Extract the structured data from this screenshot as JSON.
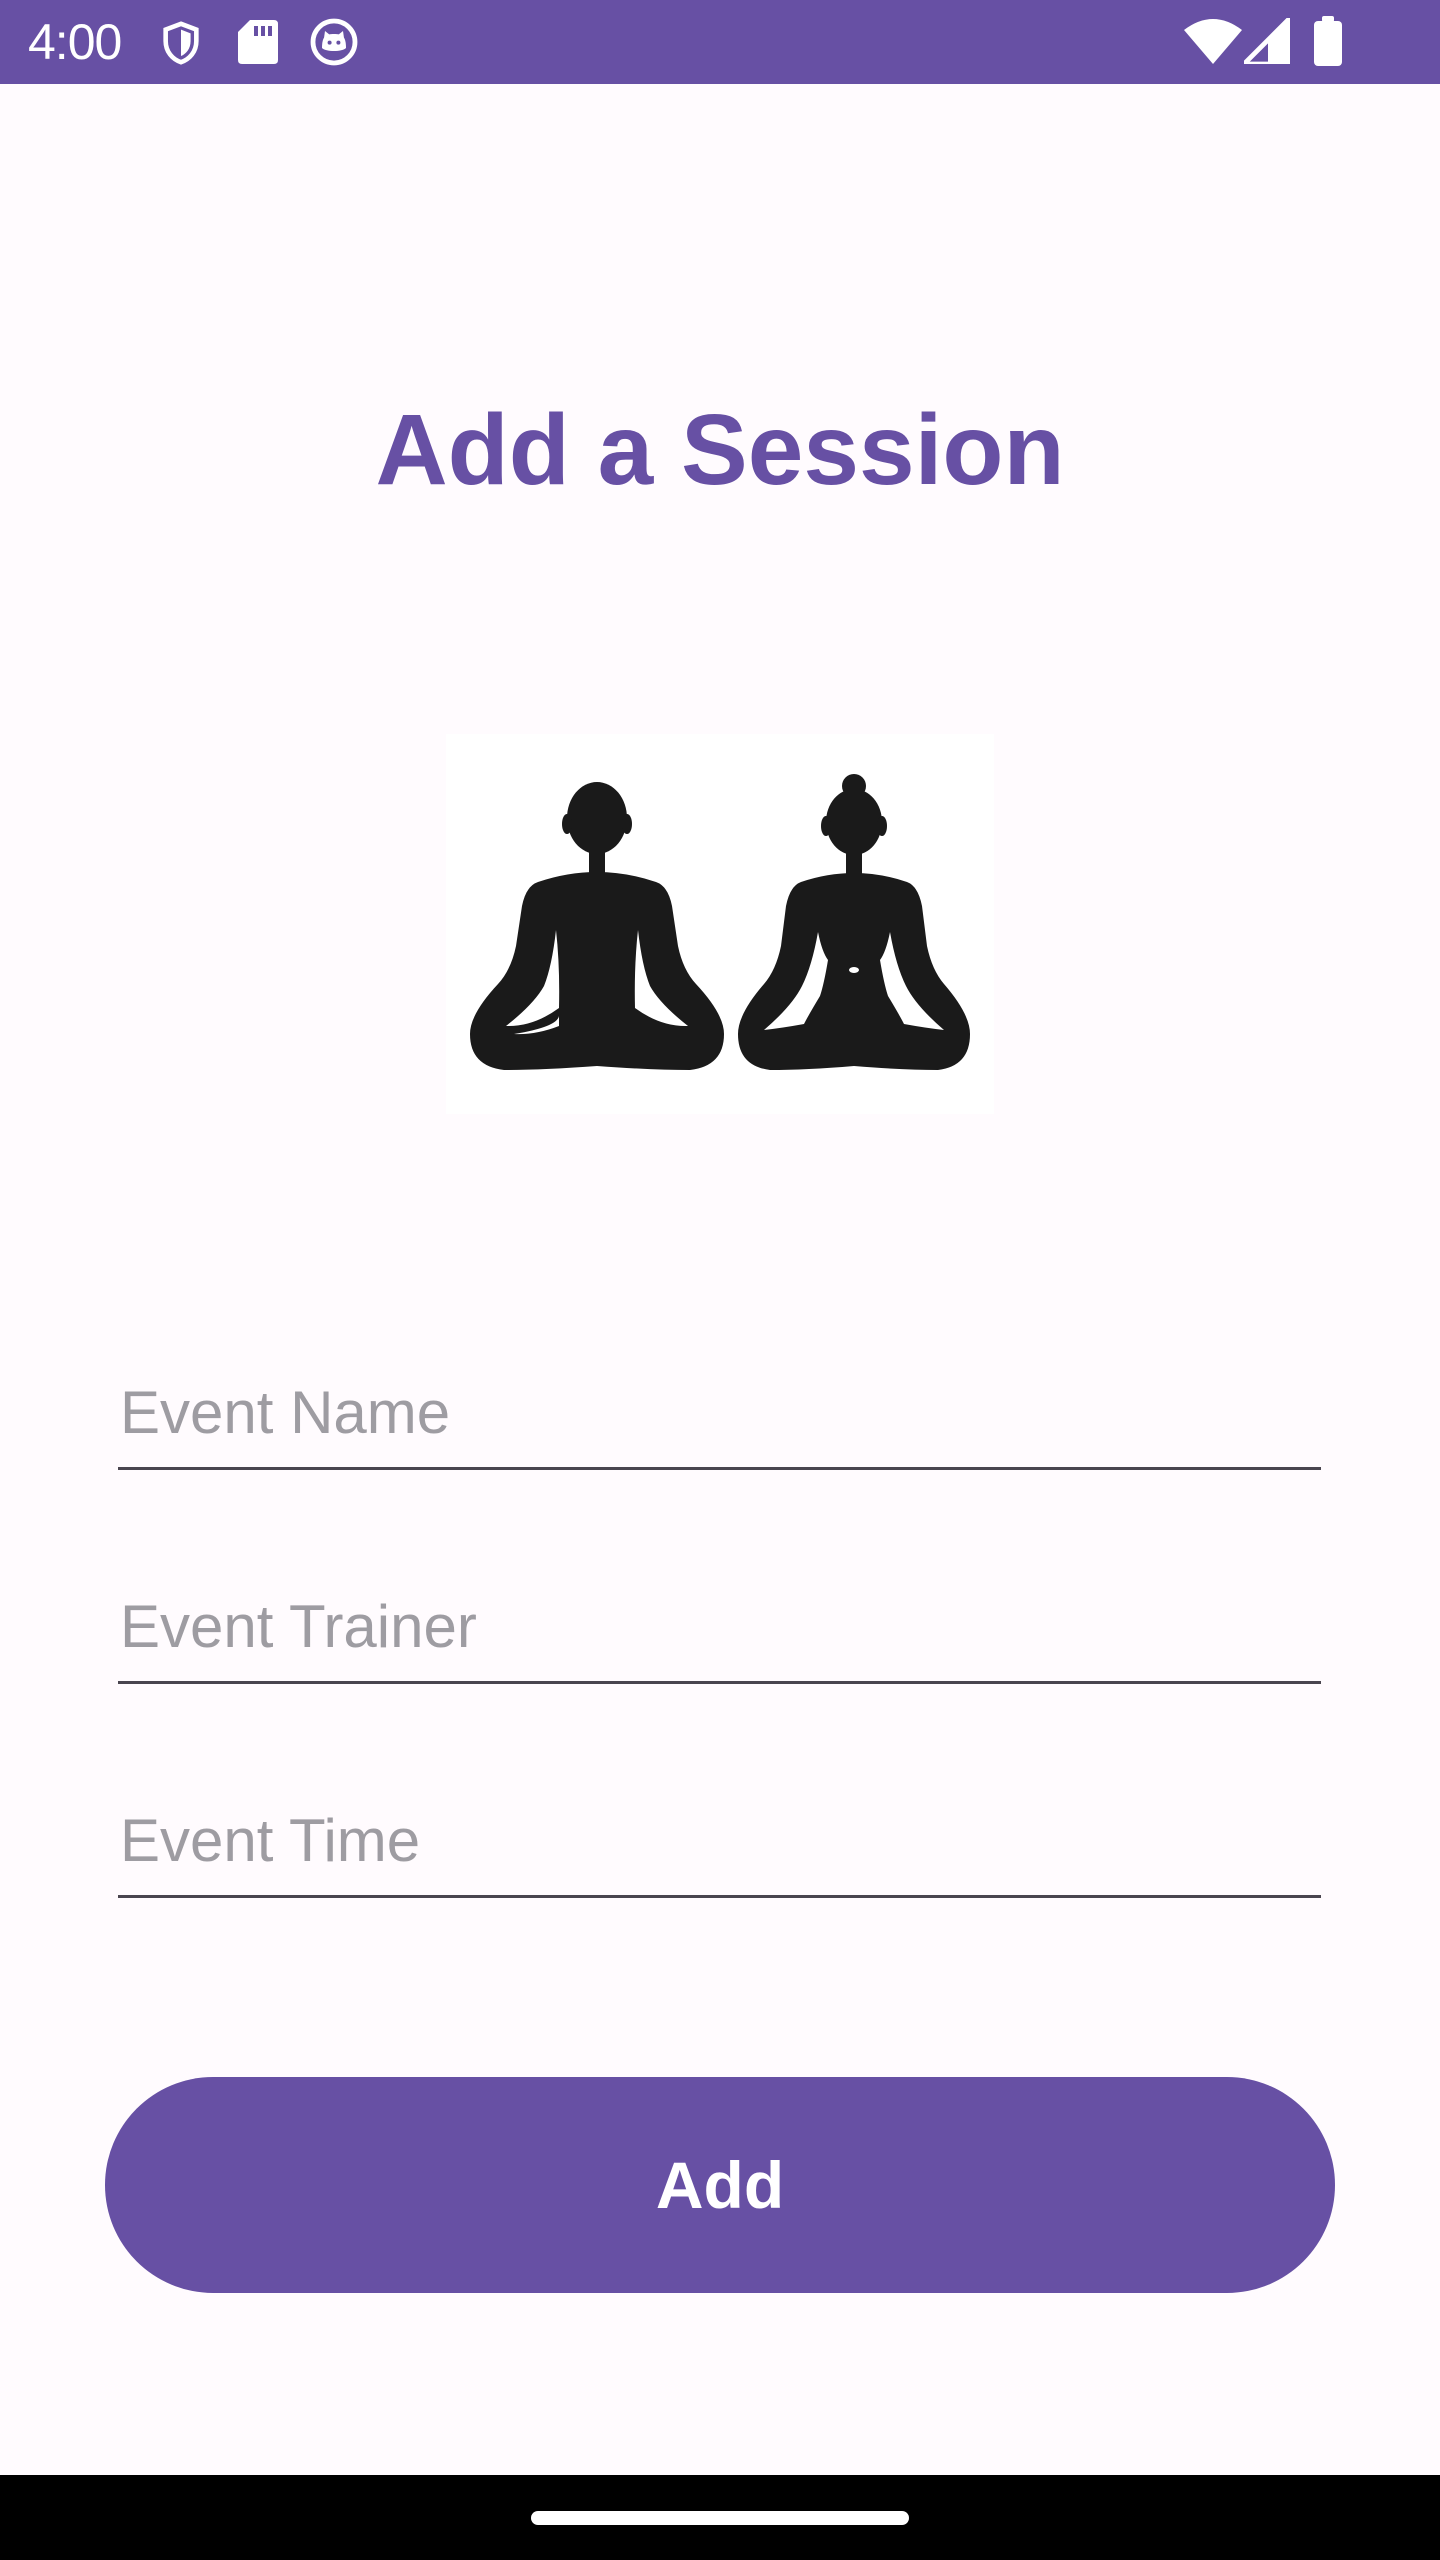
{
  "status_bar": {
    "time": "4:00",
    "left_icons": [
      "shield-icon",
      "sd-card-icon",
      "cat-face-icon"
    ],
    "right_icons": [
      "wifi-icon",
      "signal-icon",
      "battery-icon"
    ],
    "background": "#6750a4"
  },
  "screen": {
    "title": "Add a Session",
    "image_icon": "meditating-couple-icon"
  },
  "form": {
    "event_name": {
      "placeholder": "Event Name",
      "value": ""
    },
    "event_trainer": {
      "placeholder": "Event Trainer",
      "value": ""
    },
    "event_time": {
      "placeholder": "Event Time",
      "value": ""
    }
  },
  "actions": {
    "add_label": "Add"
  },
  "colors": {
    "accent": "#6750a4",
    "background": "#fffbfe",
    "placeholder": "#9e9ca2",
    "underline": "#49454f"
  }
}
